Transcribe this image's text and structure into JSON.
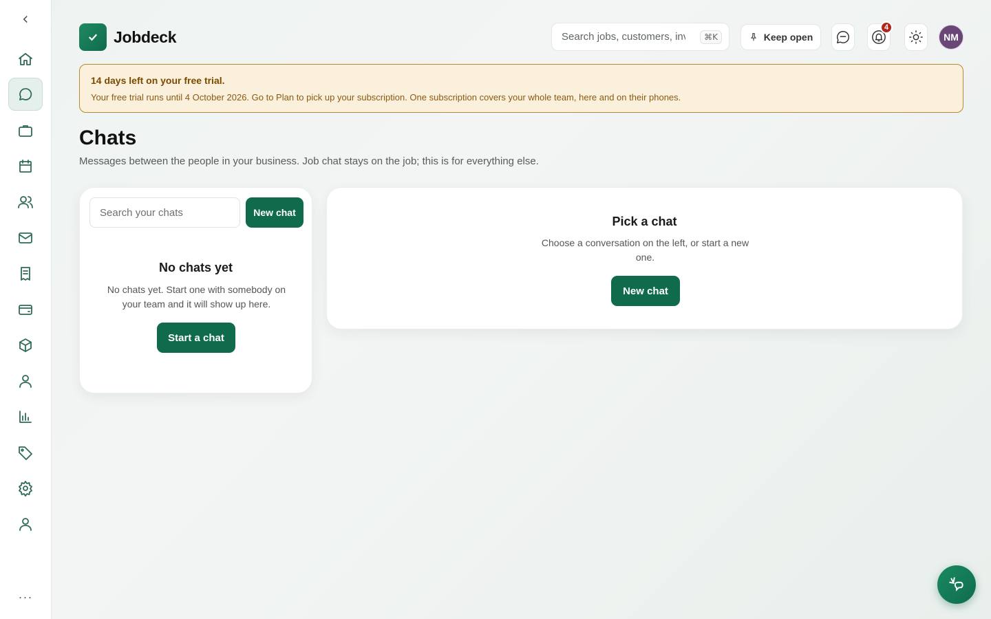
{
  "app": {
    "name": "Jobdeck"
  },
  "header": {
    "search_placeholder": "Search jobs, customers, inv",
    "search_shortcut": "⌘K",
    "keep_open_label": "Keep open",
    "notifications_count": "4",
    "avatar_initials": "NM"
  },
  "sidebar": {
    "items": [
      {
        "name": "home",
        "icon": "home-icon"
      },
      {
        "name": "chats",
        "icon": "chat-icon",
        "active": true
      },
      {
        "name": "jobs",
        "icon": "briefcase-icon"
      },
      {
        "name": "calendar",
        "icon": "calendar-icon"
      },
      {
        "name": "team",
        "icon": "users-icon"
      },
      {
        "name": "mail",
        "icon": "mail-icon"
      },
      {
        "name": "invoices",
        "icon": "receipt-icon"
      },
      {
        "name": "payments",
        "icon": "card-icon"
      },
      {
        "name": "inventory",
        "icon": "box-icon"
      },
      {
        "name": "customers",
        "icon": "user-icon"
      },
      {
        "name": "reports",
        "icon": "chart-icon"
      },
      {
        "name": "pricing",
        "icon": "tag-icon"
      },
      {
        "name": "settings",
        "icon": "gear-icon"
      },
      {
        "name": "account",
        "icon": "user-icon"
      }
    ],
    "more_label": "···"
  },
  "trial": {
    "title": "14 days left on your free trial.",
    "body": "Your free trial runs until 4 October 2026. Go to Plan to pick up your subscription. One subscription covers your whole team, here and on their phones."
  },
  "page": {
    "title": "Chats",
    "subtitle": "Messages between the people in your business. Job chat stays on the job; this is for everything else."
  },
  "chat_list": {
    "search_placeholder": "Search your chats",
    "new_chat_label": "New chat",
    "empty_title": "No chats yet",
    "empty_body": "No chats yet. Start one with somebody on your team and it will show up here.",
    "start_chat_label": "Start a chat"
  },
  "chat_view": {
    "title": "Pick a chat",
    "body": "Choose a conversation on the left, or start a new one.",
    "new_chat_label": "New chat"
  },
  "colors": {
    "brand": "#0f6b4c",
    "trial_bg": "#fbf0dc",
    "trial_border": "#b8882f",
    "badge": "#b3261e",
    "avatar": "#6a4677"
  }
}
